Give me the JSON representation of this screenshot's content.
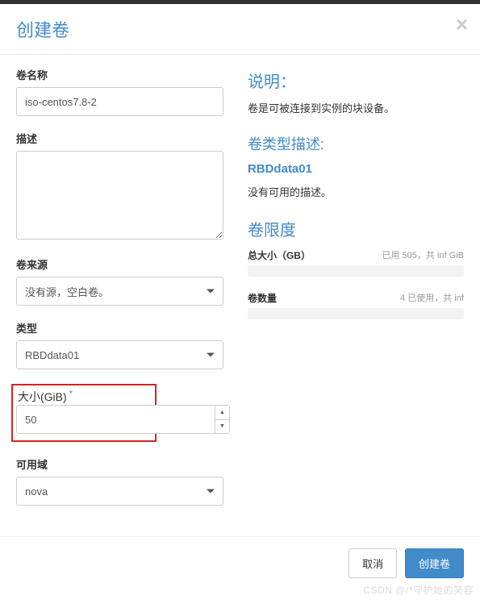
{
  "modal": {
    "title": "创建卷",
    "close": "×"
  },
  "form": {
    "name_label": "卷名称",
    "name_value": "iso-centos7.8-2",
    "desc_label": "描述",
    "desc_value": "",
    "source_label": "卷来源",
    "source_value": "没有源，空白卷。",
    "type_label": "类型",
    "type_value": "RBDdata01",
    "size_label": "大小(GiB)",
    "size_value": "50",
    "az_label": "可用域",
    "az_value": "nova"
  },
  "info": {
    "heading": "说明：",
    "text": "卷是可被连接到实例的块设备。",
    "type_heading": "卷类型描述:",
    "type_name": "RBDdata01",
    "type_desc": "没有可用的描述。",
    "limit_heading": "卷限度",
    "total_size_label": "总大小（GB）",
    "total_size_usage": "已用 505，共 inf GiB",
    "vol_count_label": "卷数量",
    "vol_count_usage": "4 已使用，共 inf"
  },
  "footer": {
    "cancel": "取消",
    "submit": "创建卷"
  },
  "watermark": "CSDN @/*守护她的笑容"
}
